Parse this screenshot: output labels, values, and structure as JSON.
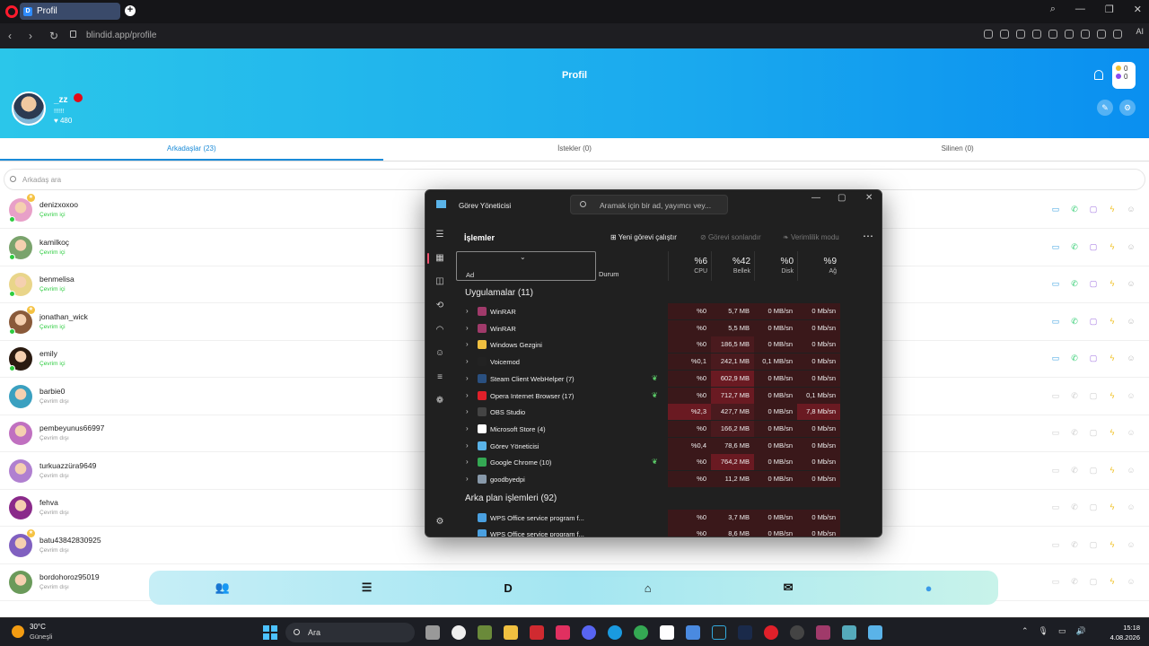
{
  "browser": {
    "tab_title": "Profil",
    "tab_favicon": "D",
    "url_domain": "blindid.app",
    "url_path": "/profile",
    "ai_label": "AI"
  },
  "page": {
    "title": "Profil",
    "user": {
      "name": "_zz",
      "status": "!!!!!!",
      "likes": "480"
    },
    "coins": {
      "gold": "0",
      "gems": "0"
    },
    "tabs": [
      {
        "label": "Arkadaşlar (23)",
        "active": true
      },
      {
        "label": "İstekler (0)",
        "active": false
      },
      {
        "label": "Silinen (0)",
        "active": false
      }
    ],
    "search_placeholder": "Arkadaş ara",
    "friends": [
      {
        "name": "denizxoxoo",
        "status": "Çevrim içi",
        "online": true,
        "star": true,
        "color": "#e8a0c8"
      },
      {
        "name": "kamilkoç",
        "status": "Çevrim içi",
        "online": true,
        "star": false,
        "color": "#7aa36c"
      },
      {
        "name": "benmelisa",
        "status": "Çevrim içi",
        "online": true,
        "star": false,
        "color": "#e9d58a"
      },
      {
        "name": "jonathan_wick",
        "status": "Çevrim içi",
        "online": true,
        "star": true,
        "color": "#8a5a3a"
      },
      {
        "name": "emily",
        "status": "Çevrim içi",
        "online": true,
        "star": false,
        "color": "#2a1a10"
      },
      {
        "name": "barbie0",
        "status": "Çevrim dışı",
        "online": false,
        "star": false,
        "color": "#3aa0c0"
      },
      {
        "name": "pembeyunus66997",
        "status": "Çevrim dışı",
        "online": false,
        "star": false,
        "color": "#c070c0"
      },
      {
        "name": "turkuazzüra9649",
        "status": "Çevrim dışı",
        "online": false,
        "star": false,
        "color": "#b080d0"
      },
      {
        "name": "fehva",
        "status": "Çevrim dışı",
        "online": false,
        "star": false,
        "color": "#8a2a8a"
      },
      {
        "name": "batu43842830925",
        "status": "Çevrim dışı",
        "online": false,
        "star": true,
        "color": "#8060c0"
      },
      {
        "name": "bordohoroz95019",
        "status": "Çevrim dışı",
        "online": false,
        "star": false,
        "color": "#6a9a5a"
      }
    ],
    "bottom_nav": [
      "friends-icon",
      "menu-icon",
      "logo-d",
      "home-icon",
      "mail-icon",
      "profile-icon"
    ],
    "bottom_nav_logo": "D"
  },
  "task_manager": {
    "title": "Görev Yöneticisi",
    "search_placeholder": "Aramak için bir ad, yayımcı vey...",
    "section": "İşlemler",
    "actions": {
      "run": "Yeni görevi çalıştır",
      "end": "Görevi sonlandır",
      "efficiency": "Verimlilik modu"
    },
    "columns": {
      "name": "Ad",
      "status": "Durum",
      "cpu": {
        "pct": "%6",
        "label": "CPU"
      },
      "mem": {
        "pct": "%42",
        "label": "Bellek"
      },
      "disk": {
        "pct": "%0",
        "label": "Disk"
      },
      "net": {
        "pct": "%9",
        "label": "Ağ"
      }
    },
    "group_apps": "Uygulamalar (11)",
    "group_bg": "Arka plan işlemleri (92)",
    "apps": [
      {
        "name": "WinRAR",
        "cpu": "%0",
        "mem": "5,7 MB",
        "disk": "0 MB/sn",
        "net": "0 Mb/sn",
        "leaf": false,
        "icon": "#a03a6a"
      },
      {
        "name": "WinRAR",
        "cpu": "%0",
        "mem": "5,5 MB",
        "disk": "0 MB/sn",
        "net": "0 Mb/sn",
        "leaf": false,
        "icon": "#a03a6a"
      },
      {
        "name": "Windows Gezgini",
        "cpu": "%0",
        "mem": "186,5 MB",
        "disk": "0 MB/sn",
        "net": "0 Mb/sn",
        "leaf": false,
        "icon": "#f0c040"
      },
      {
        "name": "Voicemod",
        "cpu": "%0,1",
        "mem": "242,1 MB",
        "disk": "0,1 MB/sn",
        "net": "0 Mb/sn",
        "leaf": false,
        "icon": "#222222"
      },
      {
        "name": "Steam Client WebHelper (7)",
        "cpu": "%0",
        "mem": "602,9 MB",
        "disk": "0 MB/sn",
        "net": "0 Mb/sn",
        "leaf": true,
        "icon": "#2a5080"
      },
      {
        "name": "Opera Internet Browser (17)",
        "cpu": "%0",
        "mem": "712,7 MB",
        "disk": "0 MB/sn",
        "net": "0,1 Mb/sn",
        "leaf": true,
        "icon": "#e0202a"
      },
      {
        "name": "OBS Studio",
        "cpu": "%2,3",
        "mem": "427,7 MB",
        "disk": "0 MB/sn",
        "net": "7,8 Mb/sn",
        "leaf": false,
        "icon": "#444444"
      },
      {
        "name": "Microsoft Store (4)",
        "cpu": "%0",
        "mem": "166,2 MB",
        "disk": "0 MB/sn",
        "net": "0 Mb/sn",
        "leaf": false,
        "icon": "#ffffff"
      },
      {
        "name": "Görev Yöneticisi",
        "cpu": "%0,4",
        "mem": "78,6 MB",
        "disk": "0 MB/sn",
        "net": "0 Mb/sn",
        "leaf": false,
        "icon": "#5ab3e8"
      },
      {
        "name": "Google Chrome (10)",
        "cpu": "%0",
        "mem": "764,2 MB",
        "disk": "0 MB/sn",
        "net": "0 Mb/sn",
        "leaf": true,
        "icon": "#34a853"
      },
      {
        "name": "goodbyedpi",
        "cpu": "%0",
        "mem": "11,2 MB",
        "disk": "0 MB/sn",
        "net": "0 Mb/sn",
        "leaf": false,
        "icon": "#8899aa"
      }
    ],
    "bg": [
      {
        "name": "WPS Office service program f...",
        "cpu": "%0",
        "mem": "3,7 MB",
        "disk": "0 MB/sn",
        "net": "0 Mb/sn",
        "icon": "#4aa0e0"
      },
      {
        "name": "WPS Office service program f...",
        "cpu": "%0",
        "mem": "8,6 MB",
        "disk": "0 MB/sn",
        "net": "0 Mb/sn",
        "icon": "#4aa0e0"
      }
    ]
  },
  "taskbar": {
    "temp": "30°C",
    "weather": "Güneşli",
    "search": "Ara",
    "time": "15:18",
    "date": "4.08.2026"
  }
}
